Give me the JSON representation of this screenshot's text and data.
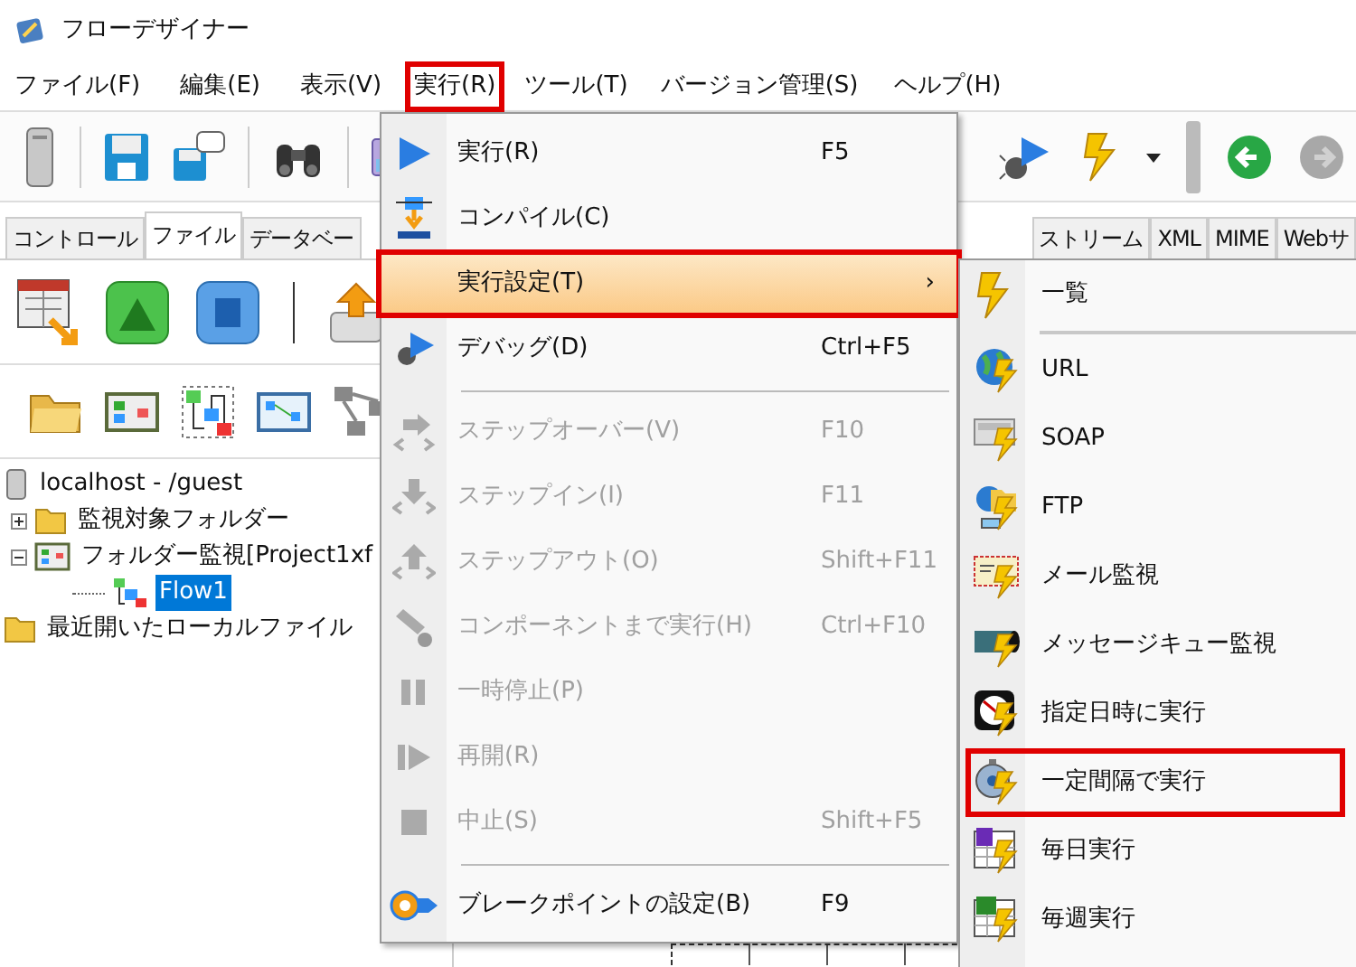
{
  "window": {
    "title": "フローデザイナー"
  },
  "menubar": [
    {
      "label": "ファイル(F)",
      "open": false,
      "annotated": false
    },
    {
      "label": "編集(E)",
      "open": false,
      "annotated": false
    },
    {
      "label": "表示(V)",
      "open": false,
      "annotated": false
    },
    {
      "label": "実行(R)",
      "open": true,
      "annotated": true
    },
    {
      "label": "ツール(T)",
      "open": false,
      "annotated": false
    },
    {
      "label": "バージョン管理(S)",
      "open": false,
      "annotated": false
    },
    {
      "label": "ヘルプ(H)",
      "open": false,
      "annotated": false
    }
  ],
  "panel_tabs": [
    {
      "label": "コントロール",
      "selected": false
    },
    {
      "label": "ファイル",
      "selected": true
    },
    {
      "label": "データベー",
      "selected": false
    }
  ],
  "editor_tabs": [
    {
      "label": "ストリーム",
      "selected": false
    },
    {
      "label": "XML",
      "selected": false
    },
    {
      "label": "MIME",
      "selected": false
    },
    {
      "label": "Webサ",
      "selected": false
    }
  ],
  "tree": [
    {
      "kind": "server",
      "label": "localhost - /guest",
      "selected": false,
      "children": [
        {
          "kind": "folder",
          "label": "監視対象フォルダー",
          "expanded": false,
          "selected": false
        },
        {
          "kind": "project",
          "label": "フォルダー監視[Project1xf",
          "expanded": true,
          "selected": false,
          "children": [
            {
              "kind": "flow",
              "label": "Flow1",
              "selected": true
            }
          ]
        }
      ]
    },
    {
      "kind": "folder",
      "label": "最近開いたローカルファイル",
      "selected": false
    }
  ],
  "run_menu": [
    {
      "kind": "item",
      "label": "実行(R)",
      "shortcut": "F5",
      "disabled": false,
      "highlighted": false,
      "annotated": false
    },
    {
      "kind": "item",
      "label": "コンパイル(C)",
      "disabled": false,
      "highlighted": false,
      "annotated": false
    },
    {
      "kind": "submenu",
      "label": "実行設定(T)",
      "arrow": "›",
      "disabled": false,
      "highlighted": true,
      "annotated": true
    },
    {
      "kind": "item",
      "label": "デバッグ(D)",
      "shortcut": "Ctrl+F5",
      "disabled": false,
      "highlighted": false,
      "annotated": false
    },
    {
      "kind": "separator"
    },
    {
      "kind": "item",
      "label": "ステップオーバー(V)",
      "shortcut": "F10",
      "disabled": true,
      "highlighted": false,
      "annotated": false
    },
    {
      "kind": "item",
      "label": "ステップイン(I)",
      "shortcut": "F11",
      "disabled": true,
      "highlighted": false,
      "annotated": false
    },
    {
      "kind": "item",
      "label": "ステップアウト(O)",
      "shortcut": "Shift+F11",
      "disabled": true,
      "highlighted": false,
      "annotated": false
    },
    {
      "kind": "item",
      "label": "コンポーネントまで実行(H)",
      "shortcut": "Ctrl+F10",
      "disabled": true,
      "highlighted": false,
      "annotated": false
    },
    {
      "kind": "item",
      "label": "一時停止(P)",
      "disabled": true,
      "highlighted": false,
      "annotated": false
    },
    {
      "kind": "item",
      "label": "再開(R)",
      "disabled": true,
      "highlighted": false,
      "annotated": false
    },
    {
      "kind": "item",
      "label": "中止(S)",
      "shortcut": "Shift+F5",
      "disabled": true,
      "highlighted": false,
      "annotated": false
    },
    {
      "kind": "separator"
    },
    {
      "kind": "item",
      "label": "ブレークポイントの設定(B)",
      "shortcut": "F9",
      "disabled": false,
      "highlighted": false,
      "annotated": false
    }
  ],
  "run_settings_submenu": [
    {
      "kind": "item",
      "label": "一覧",
      "annotated": false
    },
    {
      "kind": "separator"
    },
    {
      "kind": "item",
      "label": "URL",
      "annotated": false
    },
    {
      "kind": "item",
      "label": "SOAP",
      "annotated": false
    },
    {
      "kind": "item",
      "label": "FTP",
      "annotated": false
    },
    {
      "kind": "item",
      "label": "メール監視",
      "annotated": false
    },
    {
      "kind": "item",
      "label": "メッセージキュー監視",
      "annotated": false
    },
    {
      "kind": "item",
      "label": "指定日時に実行",
      "annotated": false
    },
    {
      "kind": "item",
      "label": "一定間隔で実行",
      "annotated": true
    },
    {
      "kind": "item",
      "label": "毎日実行",
      "annotated": false
    },
    {
      "kind": "item",
      "label": "毎週実行",
      "annotated": false
    }
  ]
}
